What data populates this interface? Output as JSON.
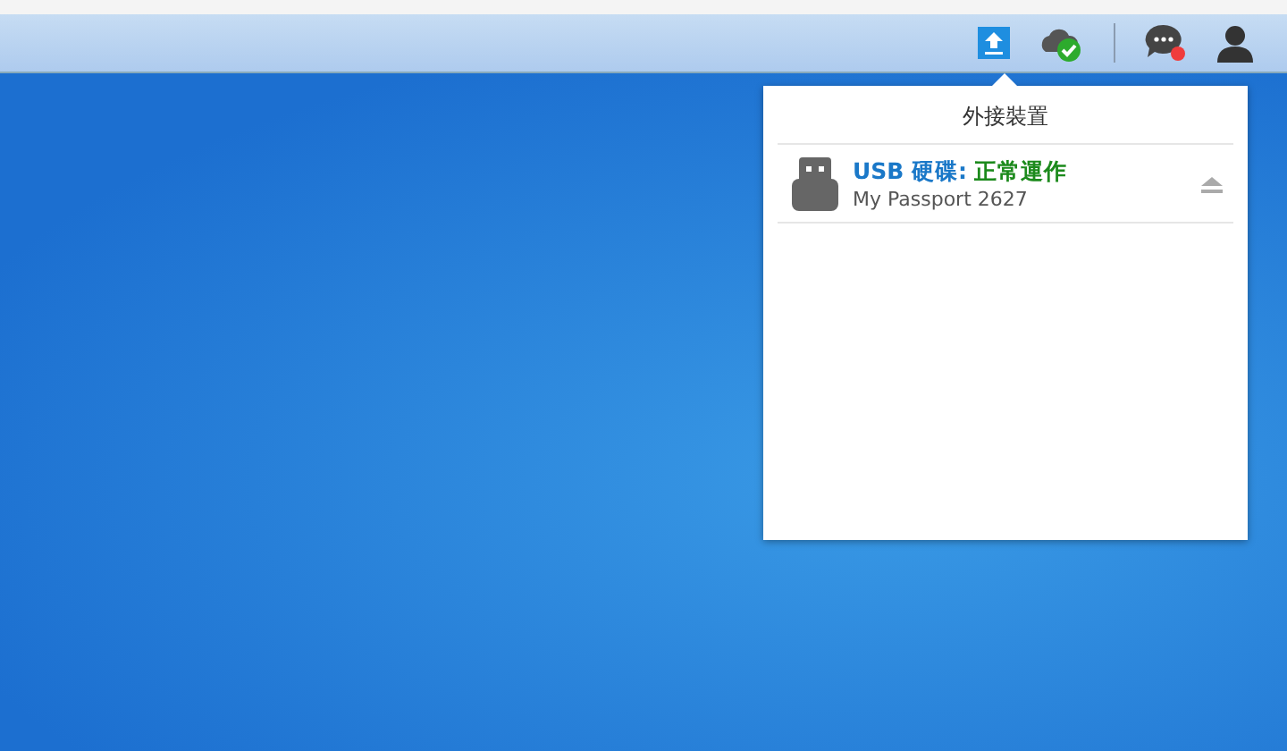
{
  "popup": {
    "title": "外接裝置",
    "devices": [
      {
        "name": "USB 硬碟:",
        "status": "正常運作",
        "model": "My Passport 2627"
      }
    ]
  }
}
